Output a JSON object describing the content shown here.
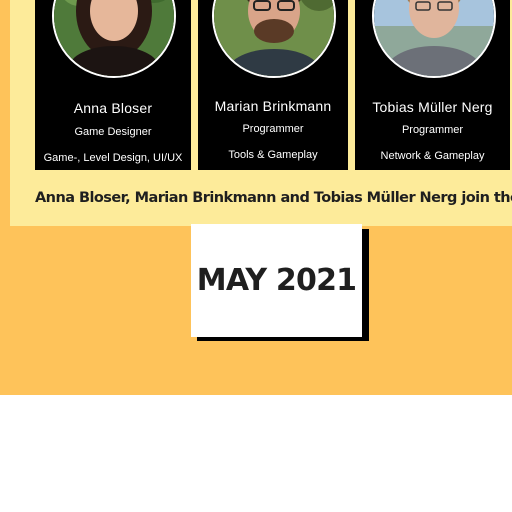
{
  "team_members": [
    {
      "name": "Anna Bloser",
      "role": "Game Designer",
      "focus": "Game-, Level Design, UI/UX"
    },
    {
      "name": "Marian Brinkmann",
      "role": "Programmer",
      "focus": "Tools & Gameplay"
    },
    {
      "name": "Tobias Müller Nerg",
      "role": "Programmer",
      "focus": "Network & Gameplay"
    }
  ],
  "announcement": "Anna Bloser, Marian Brinkmann and Tobias Müller Nerg join the team",
  "timeline_date": "MAY 2021",
  "colors": {
    "page_background": "#ffffff",
    "orange_band": "#fec35a",
    "yellow_panel": "#fdeb9a",
    "card_background": "#000000",
    "date_box_background": "#ffffff",
    "date_box_shadow": "#000000"
  }
}
